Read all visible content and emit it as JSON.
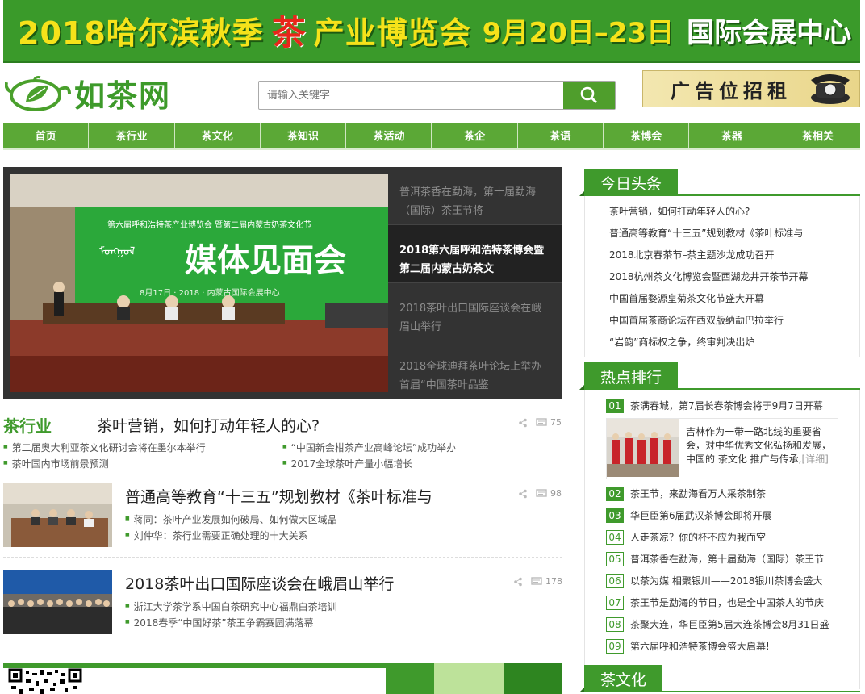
{
  "banner": {
    "part1": "2018哈尔滨秋季",
    "part2": "茶",
    "part3": "产业博览会",
    "part4": "9月20日–23日",
    "part5": "国际会展中心"
  },
  "logo": {
    "text": "如茶网"
  },
  "search": {
    "placeholder": "请输入关键字"
  },
  "ad": {
    "text": "广告位招租"
  },
  "nav": [
    "首页",
    "茶行业",
    "茶文化",
    "茶知识",
    "茶活动",
    "茶企",
    "茶语",
    "茶博会",
    "茶器",
    "茶相关"
  ],
  "slider": {
    "items": [
      "普洱茶香在勐海，第十届勐海（国际）茶王节将",
      "2018第六届呼和浩特茶博会暨第二届内蒙古奶茶文",
      "2018茶叶出口国际座谈会在峨眉山举行",
      "2018全球迪拜茶叶论坛上举办首届“中国茶叶品鉴"
    ],
    "active": 1
  },
  "industry": {
    "title": "茶行业",
    "articles": [
      {
        "headline": "茶叶营销，如何打动年轻人的心?",
        "comments": "75",
        "links": [
          "第二届奥大利亚茶文化研讨会将在墨尔本举行",
          "茶叶国内市场前景预测",
          "“中国新会柑茶产业高峰论坛”成功举办",
          "2017全球茶叶产量小幅增长"
        ]
      },
      {
        "headline": "普通高等教育“十三五”规划教材《茶叶标准与",
        "comments": "98",
        "links": [
          "蒋同：茶叶产业发展如何破局、如何做大区域品",
          "刘仲华：茶行业需要正确处理的十大关系"
        ]
      },
      {
        "headline": "2018茶叶出口国际座谈会在峨眉山举行",
        "comments": "178",
        "links": [
          "浙江大学茶学系中国白茶研究中心福鼎白茶培训",
          "2018春季“中国好茶”茶王争霸赛圆满落幕"
        ]
      }
    ]
  },
  "today": {
    "title": "今日头条",
    "items": [
      "茶叶营销，如何打动年轻人的心?",
      "普通高等教育“十三五”规划教材《茶叶标准与",
      "2018北京春茶节–茶主题沙龙成功召开",
      "2018杭州茶文化博览会暨西湖龙井开茶节开幕",
      "中国首届婺源皇菊茶文化节盛大开幕",
      "中国首届茶商论坛在西双版纳勐巴拉举行",
      "“岩韵”商标权之争，终审判决出炉"
    ]
  },
  "hot": {
    "title": "热点排行",
    "feature": {
      "text": "吉林作为一带一路北线的重要省会，对中华优秀文化弘扬和发展，中国的 茶文化 推广与传承,",
      "more": "[详细]"
    },
    "items": [
      {
        "n": "01",
        "t": "茶满春城，第7届长春茶博会将于9月7日开幕"
      },
      {
        "n": "02",
        "t": "茶王节，来勐海看万人采茶制茶"
      },
      {
        "n": "03",
        "t": "华巨臣第6届武汉茶博会即将开展"
      },
      {
        "n": "04",
        "t": "人走茶凉？你的杯不应为我而空"
      },
      {
        "n": "05",
        "t": "普洱茶香在勐海，第十届勐海（国际）茶王节"
      },
      {
        "n": "06",
        "t": "以茶为媒 相聚银川——2018银川茶博会盛大"
      },
      {
        "n": "07",
        "t": "茶王节是勐海的节日，也是全中国茶人的节庆"
      },
      {
        "n": "08",
        "t": "茶聚大连，华巨臣第5届大连茶博会8月31日盛"
      },
      {
        "n": "09",
        "t": "第六届呼和浩特茶博会盛大启幕!"
      }
    ]
  },
  "culture": {
    "title": "茶文化"
  },
  "photo": {
    "banner_text": "媒体见面会"
  },
  "colors": {
    "brand_green": "#3f9a2c",
    "nav_green": "#5ba836",
    "slider_bg": "#333333"
  }
}
